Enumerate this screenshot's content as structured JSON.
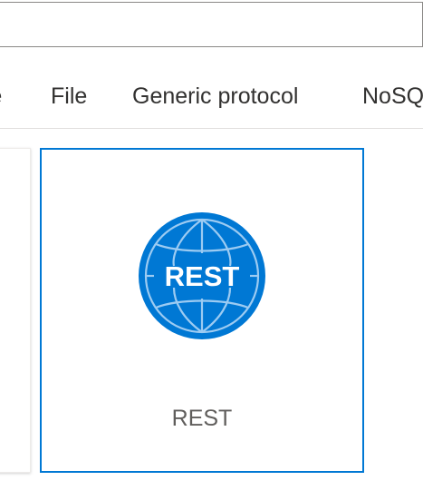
{
  "search": {
    "value": "",
    "placeholder": ""
  },
  "tabs": [
    {
      "label": "re"
    },
    {
      "label": "File"
    },
    {
      "label": "Generic protocol"
    },
    {
      "label": "NoSQL"
    }
  ],
  "cards": [
    {
      "label": "REST",
      "logo_text": "REST",
      "icon": "globe-icon",
      "selected": true,
      "accent_color": "#0078d4"
    }
  ],
  "colors": {
    "accent": "#0078d4",
    "text": "#323130",
    "secondary_text": "#605e5c"
  }
}
